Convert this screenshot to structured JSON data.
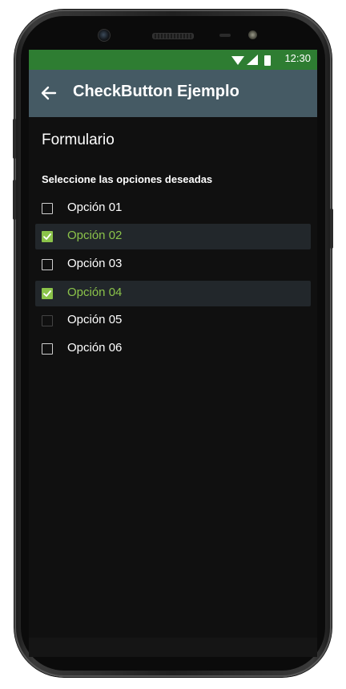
{
  "status_bar": {
    "time": "12:30",
    "color": "#2e7d32",
    "icons": [
      "wifi-icon",
      "signal-icon",
      "battery-icon"
    ]
  },
  "app_bar": {
    "title": "CheckButton Ejemplo",
    "back_icon": "arrow-left-icon",
    "color": "#455a64"
  },
  "form": {
    "title": "Formulario",
    "subtitle": "Seleccione las opciones deseadas",
    "accent": "#8bc34a",
    "options": [
      {
        "label": "Opción 01",
        "checked": false
      },
      {
        "label": "Opción 02",
        "checked": true
      },
      {
        "label": "Opción 03",
        "checked": false
      },
      {
        "label": "Opción 04",
        "checked": true
      },
      {
        "label": "Opción 05",
        "checked": false
      },
      {
        "label": "Opción 06",
        "checked": false
      }
    ]
  }
}
